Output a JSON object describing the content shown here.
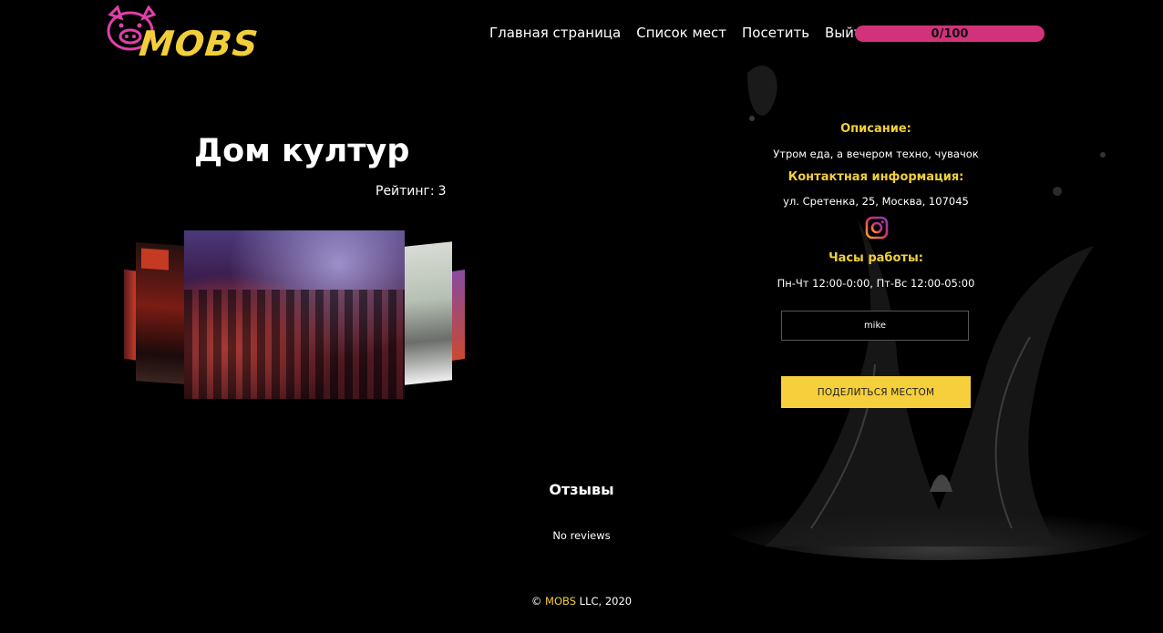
{
  "header": {
    "logo_text": "MOBS",
    "nav": [
      {
        "label": "Главная страница"
      },
      {
        "label": "Список мест"
      },
      {
        "label": "Посетить"
      },
      {
        "label": "Выйти"
      }
    ],
    "progress": {
      "label": "0/100",
      "value": 0,
      "max": 100,
      "color": "#d2327a"
    }
  },
  "place": {
    "title": "Дом култур",
    "rating_label": "Рейтинг:",
    "rating_value": "3"
  },
  "info": {
    "description_heading": "Описание:",
    "description_text": "Утром еда, а вечером техно, чувачок",
    "contact_heading": "Контактная информация:",
    "contact_text": "ул. Сретенка, 25, Москва, 107045",
    "social_icon": "instagram-icon",
    "hours_heading": "Часы работы:",
    "hours_text": "Пн-Чт 12:00-0:00, Пт-Вс 12:00-05:00"
  },
  "share": {
    "input_value": "mike",
    "button_label": "ПОДЕЛИТЬСЯ МЕСТОМ"
  },
  "reviews": {
    "heading": "Отзывы",
    "empty_text": "No reviews"
  },
  "footer": {
    "copyright": "©",
    "brand": "MOBS",
    "rest": "LLC, 2020"
  },
  "colors": {
    "accent_yellow": "#f2cf3a",
    "accent_pink": "#d2327a",
    "background": "#000000"
  }
}
